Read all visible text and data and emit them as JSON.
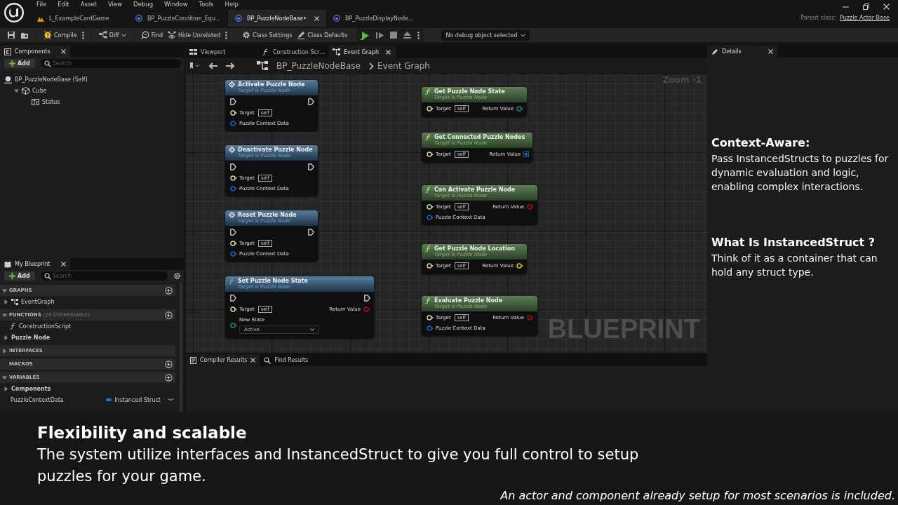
{
  "window": {
    "menu": [
      "File",
      "Edit",
      "Asset",
      "View",
      "Debug",
      "Window",
      "Tools",
      "Help"
    ],
    "doc_tabs": [
      {
        "label": "L_ExampleCardGame",
        "kind": "level",
        "selected": false
      },
      {
        "label": "BP_PuzzleCondition_Equ…",
        "kind": "blueprint",
        "selected": false
      },
      {
        "label": "BP_PuzzleNodeBase•",
        "kind": "blueprint",
        "selected": true
      },
      {
        "label": "BP_PuzzleDisplayNode…",
        "kind": "blueprint",
        "selected": false
      }
    ],
    "parent_class_label": "Parent class:",
    "parent_class": "Puzzle Actor Base"
  },
  "toolbar": {
    "buttons": [
      {
        "kind": "save"
      },
      {
        "kind": "browse"
      },
      {
        "kind": "compile",
        "label": "Compile",
        "more": true
      },
      {
        "kind": "diff",
        "label": "Diff",
        "dropdown": true
      },
      {
        "kind": "find",
        "label": "Find"
      },
      {
        "kind": "hide",
        "label": "Hide Unrelated",
        "more": true
      },
      {
        "kind": "settings",
        "label": "Class Settings"
      },
      {
        "kind": "defaults",
        "label": "Class Defaults"
      }
    ],
    "debug_object": "No debug object selected"
  },
  "components": {
    "title": "Components",
    "add": "Add",
    "search_placeholder": "Search",
    "tree": [
      {
        "label": "BP_PuzzleNodeBase (Self)",
        "kind": "actor",
        "children": [
          {
            "label": "Cube",
            "kind": "mesh",
            "expanded": true,
            "children": [
              {
                "label": "Status",
                "kind": "text"
              }
            ]
          }
        ]
      }
    ]
  },
  "my_blueprint": {
    "title": "My Blueprint",
    "add": "Add",
    "search_placeholder": "Search",
    "sections": [
      {
        "title": "GRAPHS",
        "expanded": true,
        "addable": true,
        "items": [
          {
            "kind": "graph",
            "label": "EventGraph",
            "expanded": false
          }
        ]
      },
      {
        "title": "FUNCTIONS",
        "count": "(26 OVERRIDABLE)",
        "expanded": true,
        "addable": true,
        "items": [
          {
            "kind": "function",
            "label": "ConstructionScript"
          },
          {
            "kind": "category",
            "label": "Puzzle Node",
            "expanded": false
          }
        ]
      },
      {
        "title": "INTERFACES",
        "expanded": false,
        "addable": false
      },
      {
        "title": "MACROS",
        "addable": true
      },
      {
        "title": "VARIABLES",
        "expanded": true,
        "addable": true,
        "items": [
          {
            "kind": "category",
            "label": "Components",
            "expanded": false
          },
          {
            "kind": "variable",
            "label": "PuzzleContextData",
            "type": "Instanced Struct",
            "color": "#1f6fe0"
          }
        ]
      }
    ]
  },
  "editor_tabs": [
    {
      "label": "Viewport",
      "kind": "viewport",
      "selected": false
    },
    {
      "label": "Construction Scr…",
      "kind": "function",
      "selected": false
    },
    {
      "label": "Event Graph",
      "kind": "graph",
      "selected": true
    }
  ],
  "breadcrumb": [
    "BP_PuzzleNodeBase",
    "Event Graph"
  ],
  "graph": {
    "zoom": "Zoom -1",
    "watermark": "BLUEPRINT",
    "nodes": [
      {
        "kind": "interface_call",
        "title": "Activate Puzzle Node",
        "subtitle": "Target is Puzzle Node",
        "inputs": [
          {
            "label": "Target",
            "kind": "object",
            "value": "self"
          },
          {
            "label": "Puzzle Context Data",
            "kind": "struct"
          }
        ]
      },
      {
        "kind": "interface_call",
        "title": "Deactivate Puzzle Node",
        "subtitle": "Target is Puzzle Node",
        "inputs": [
          {
            "label": "Target",
            "kind": "object",
            "value": "self"
          },
          {
            "label": "Puzzle Context Data",
            "kind": "struct"
          }
        ]
      },
      {
        "kind": "interface_call",
        "title": "Reset Puzzle Node",
        "subtitle": "Target is Puzzle Node",
        "inputs": [
          {
            "label": "Target",
            "kind": "object",
            "value": "self"
          },
          {
            "label": "Puzzle Context Data",
            "kind": "struct"
          }
        ]
      },
      {
        "kind": "function_call",
        "title": "Set Puzzle Node State",
        "subtitle": "Target is Puzzle Node",
        "inputs": [
          {
            "label": "Target",
            "kind": "object",
            "value": "self"
          },
          {
            "label": "New State",
            "kind": "enum",
            "choice": "Active"
          }
        ],
        "outputs": [
          {
            "label": "Return Value",
            "kind": "bool"
          }
        ]
      },
      {
        "kind": "pure_function",
        "title": "Get Puzzle Node State",
        "subtitle": "Target is Puzzle Node",
        "inputs": [
          {
            "label": "Target",
            "kind": "object",
            "value": "self"
          }
        ],
        "outputs": [
          {
            "label": "Return Value",
            "kind": "enum"
          }
        ]
      },
      {
        "kind": "pure_function",
        "title": "Get Connected Puzzle Nodes",
        "subtitle": "Target is Puzzle Node",
        "inputs": [
          {
            "label": "Target",
            "kind": "object",
            "value": "self"
          }
        ],
        "outputs": [
          {
            "label": "Return Value",
            "kind": "array"
          }
        ]
      },
      {
        "kind": "pure_function",
        "title": "Can Activate Puzzle Node",
        "subtitle": "Target is Puzzle Node",
        "inputs": [
          {
            "label": "Target",
            "kind": "object",
            "value": "self"
          },
          {
            "label": "Puzzle Context Data",
            "kind": "struct"
          }
        ],
        "outputs": [
          {
            "label": "Return Value",
            "kind": "bool"
          }
        ]
      },
      {
        "kind": "pure_function",
        "title": "Get Puzzle Node Location",
        "subtitle": "Target is Puzzle Node",
        "inputs": [
          {
            "label": "Target",
            "kind": "object",
            "value": "self"
          }
        ],
        "outputs": [
          {
            "label": "Return Value",
            "kind": "vector"
          }
        ]
      },
      {
        "kind": "pure_function",
        "title": "Evaluate Puzzle Node",
        "subtitle": "Target is Puzzle Node",
        "inputs": [
          {
            "label": "Target",
            "kind": "object",
            "value": "self"
          },
          {
            "label": "Puzzle Context Data",
            "kind": "struct"
          }
        ],
        "outputs": [
          {
            "label": "Return Value",
            "kind": "bool"
          }
        ]
      }
    ]
  },
  "details": {
    "title": "Details",
    "notes": [
      {
        "heading": "Context-Aware:",
        "body": "Pass InstancedStructs to puzzles for dynamic evaluation and logic, enabling complex interactions."
      },
      {
        "heading": "What Is InstancedStruct ?",
        "body": "Think of it as a container that can hold any struct type."
      }
    ]
  },
  "bottom_tabs": [
    {
      "label": "Compiler Results",
      "kind": "compiler",
      "selected": true
    },
    {
      "label": "Find Results",
      "kind": "find",
      "selected": false
    }
  ],
  "caption": {
    "title": "Flexibility and scalable",
    "body": "The system utilize interfaces and InstancedStruct to give you full control to setup puzzles for your game.",
    "footnote": "An actor and component already setup for most scenarios is included."
  }
}
